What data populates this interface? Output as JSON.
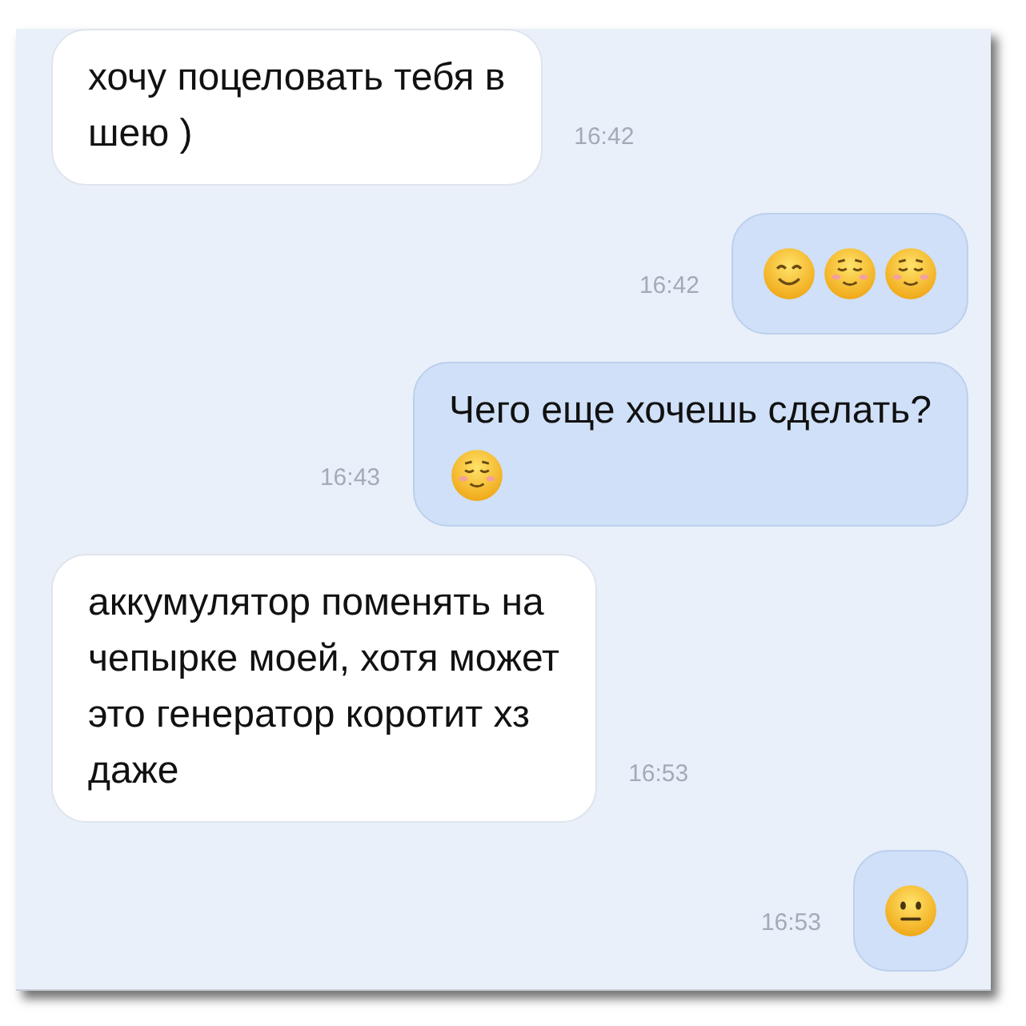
{
  "messages": [
    {
      "kind": "incoming",
      "text": "хочу поцеловать тебя в\nшею )",
      "time": "16:42"
    },
    {
      "kind": "outgoing",
      "emojis": [
        {
          "kind": "smile"
        },
        {
          "kind": "blush"
        },
        {
          "kind": "blush"
        }
      ],
      "time": "16:42"
    },
    {
      "kind": "outgoing",
      "text": "Чего еще хочешь сделать?",
      "emojis": [
        {
          "kind": "blush"
        }
      ],
      "time": "16:43"
    },
    {
      "kind": "incoming",
      "text": "аккумулятор поменять на\nчепырке моей, хотя может\nэто генератор коротит хз\nдаже",
      "time": "16:53"
    },
    {
      "kind": "outgoing",
      "emojis": [
        {
          "kind": "neutral"
        }
      ],
      "time": "16:53"
    }
  ]
}
